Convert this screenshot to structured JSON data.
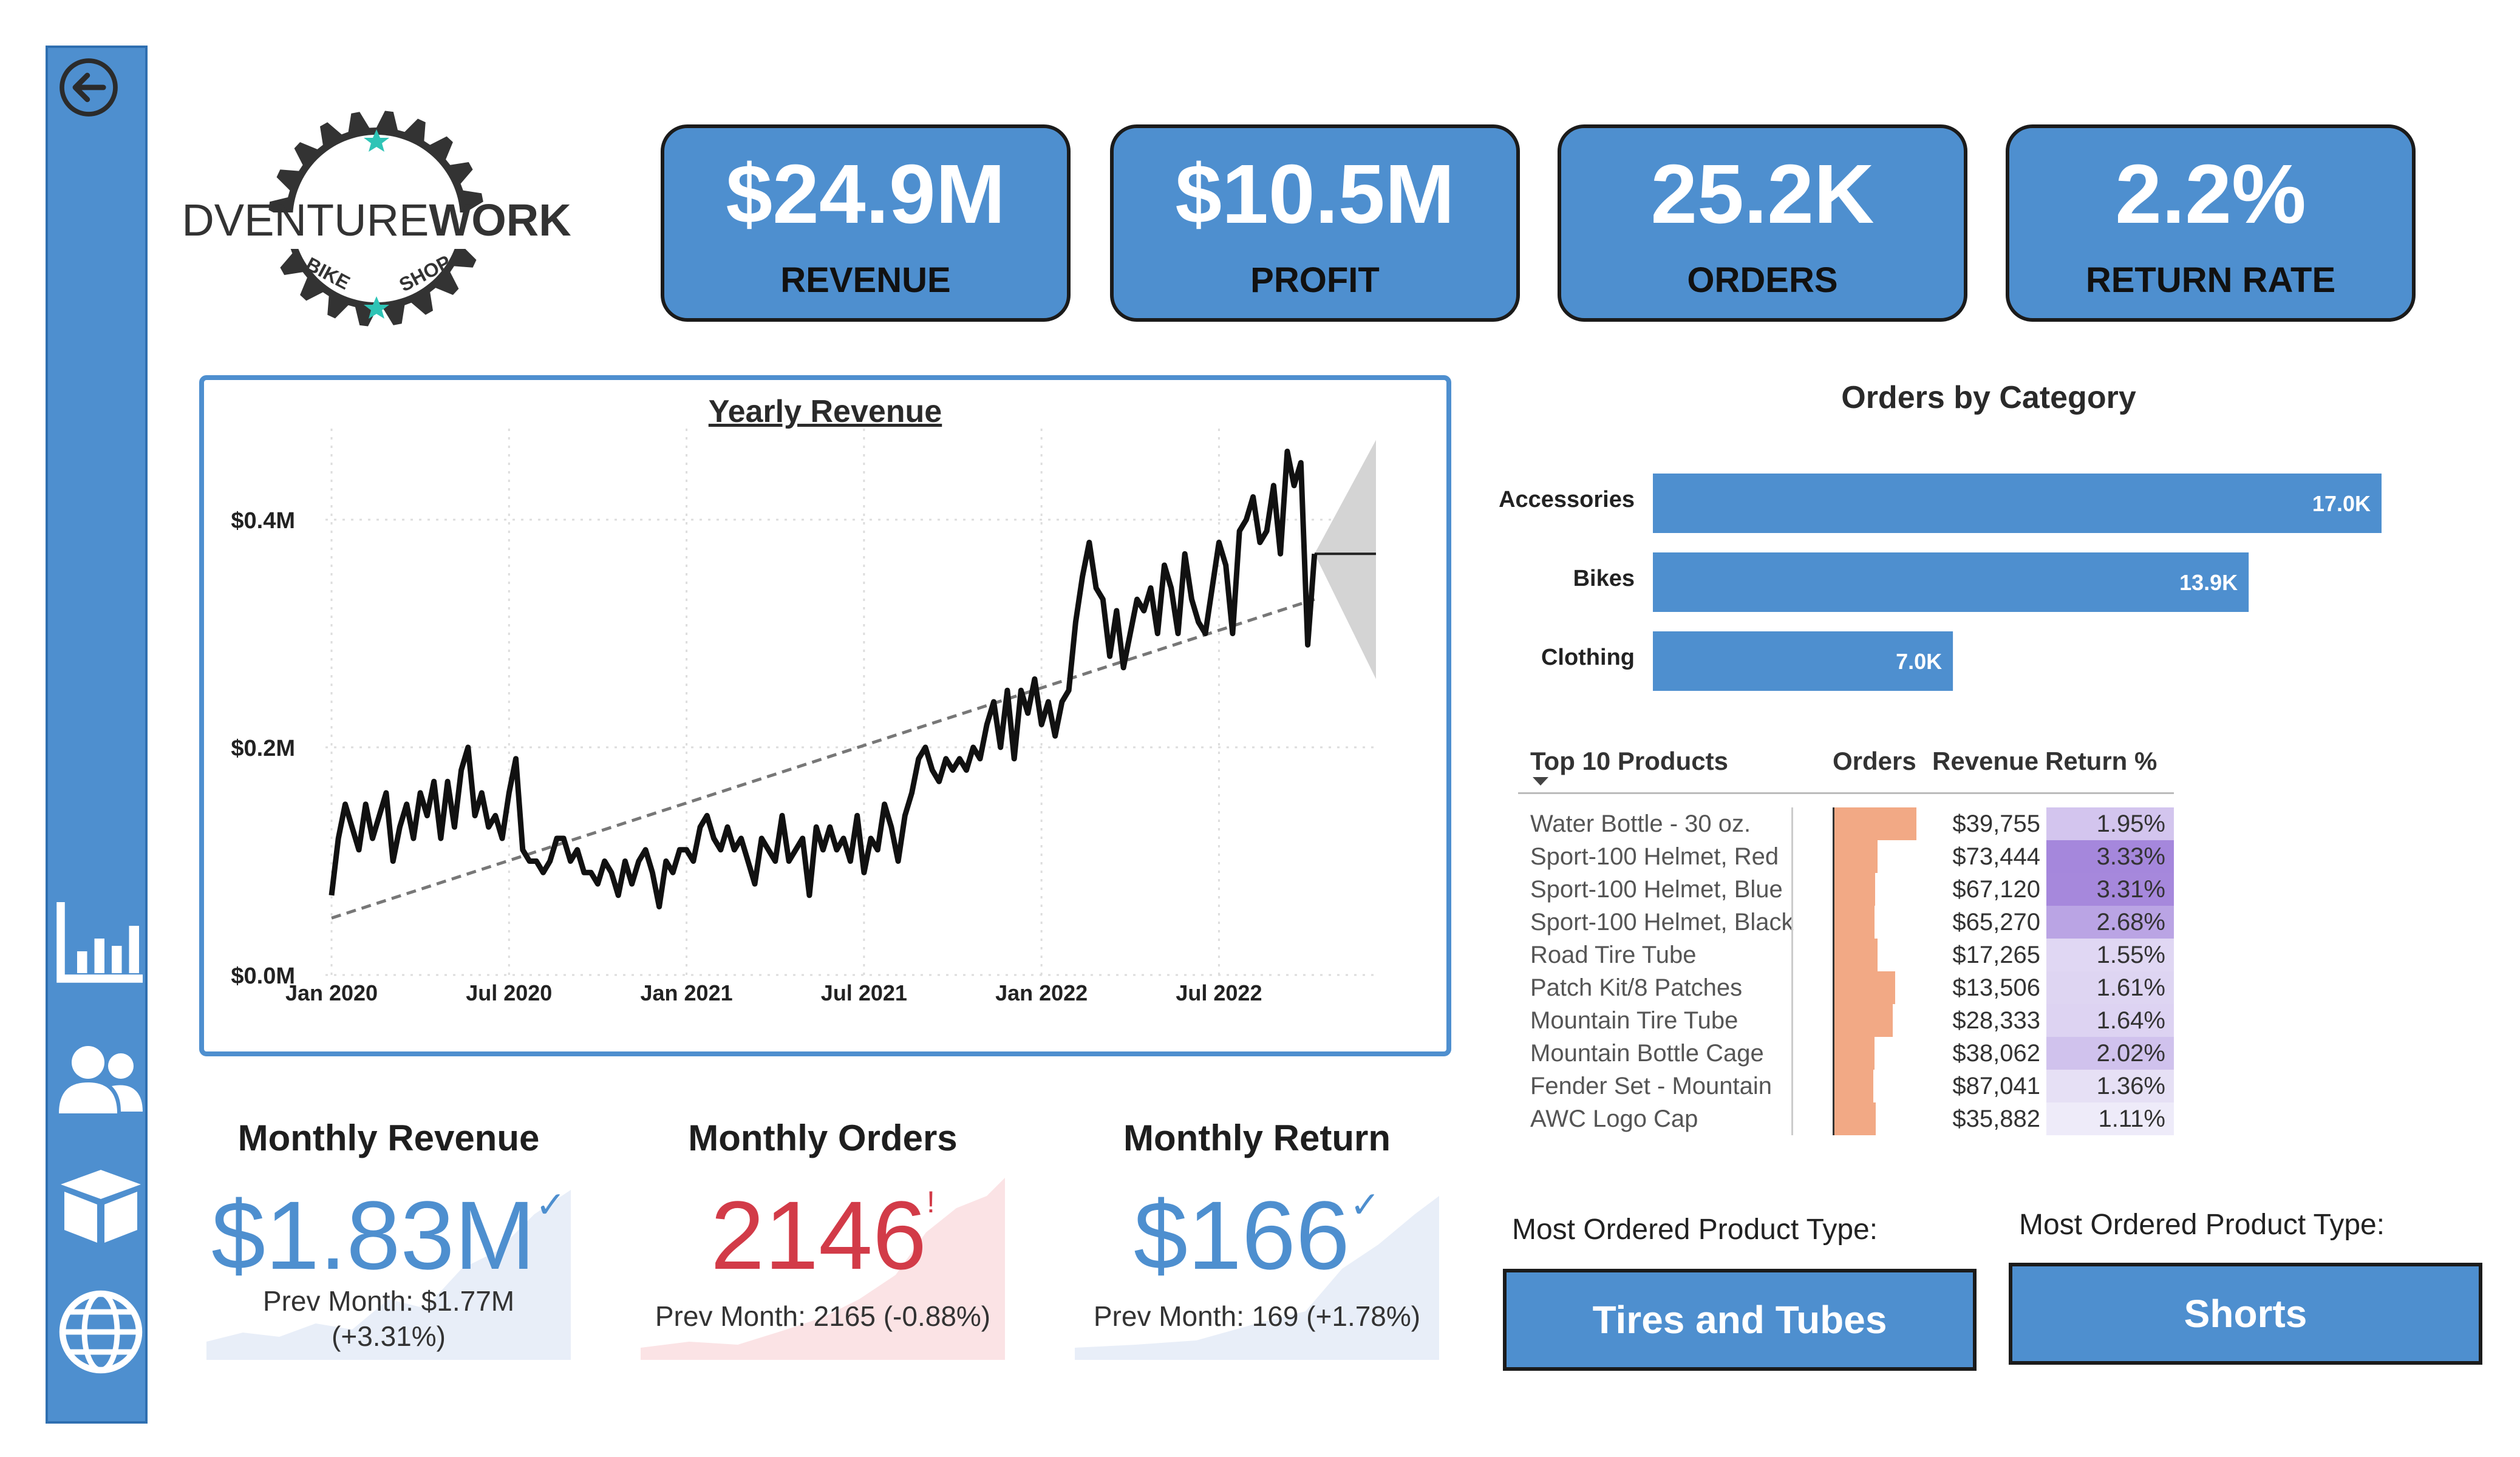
{
  "sidebar": {
    "items": [
      {
        "icon": "back-icon"
      },
      {
        "icon": "bar-chart-icon"
      },
      {
        "icon": "people-icon"
      },
      {
        "icon": "box-icon"
      },
      {
        "icon": "globe-icon"
      }
    ],
    "color": "#4e8fcf"
  },
  "logo": {
    "main_light": "ADVENTURE",
    "main_bold": "WORKS",
    "sub_left": "BIKE",
    "sub_right": "SHOP"
  },
  "kpis": [
    {
      "value": "$24.9M",
      "label": "REVENUE"
    },
    {
      "value": "$10.5M",
      "label": "PROFIT"
    },
    {
      "value": "25.2K",
      "label": "ORDERS"
    },
    {
      "value": "2.2%",
      "label": "RETURN RATE"
    }
  ],
  "yearly_revenue": {
    "title": "Yearly Revenue",
    "ytick_labels": [
      "$0.0M",
      "$0.2M",
      "$0.4M"
    ],
    "xtick_labels": [
      "Jan 2020",
      "Jul 2020",
      "Jan 2021",
      "Jul 2021",
      "Jan 2022",
      "Jul 2022"
    ]
  },
  "chart_data": [
    {
      "type": "line",
      "title": "Yearly Revenue",
      "ylabel": "",
      "xlabel": "",
      "ylim": [
        0,
        0.48
      ],
      "y_unit": "$M",
      "x_range": [
        "2020-01",
        "2022-10"
      ],
      "series": [
        {
          "values": [
            0.07,
            0.12,
            0.15,
            0.13,
            0.11,
            0.15,
            0.12,
            0.14,
            0.16,
            0.1,
            0.13,
            0.15,
            0.12,
            0.16,
            0.14,
            0.17,
            0.12,
            0.17,
            0.13,
            0.18,
            0.2,
            0.14,
            0.16,
            0.13,
            0.14,
            0.12,
            0.16,
            0.19,
            0.11,
            0.1,
            0.1,
            0.09,
            0.1,
            0.12,
            0.12,
            0.1,
            0.11,
            0.09,
            0.09,
            0.08,
            0.1,
            0.09,
            0.07,
            0.1,
            0.08,
            0.1,
            0.11,
            0.09,
            0.06,
            0.1,
            0.09,
            0.11,
            0.11,
            0.1,
            0.13,
            0.14,
            0.12,
            0.11,
            0.13,
            0.11,
            0.12,
            0.1,
            0.08,
            0.12,
            0.11,
            0.1,
            0.14,
            0.1,
            0.11,
            0.12,
            0.07,
            0.13,
            0.11,
            0.13,
            0.11,
            0.12,
            0.1,
            0.14,
            0.09,
            0.12,
            0.11,
            0.15,
            0.13,
            0.1,
            0.14,
            0.16,
            0.19,
            0.2,
            0.18,
            0.17,
            0.19,
            0.18,
            0.19,
            0.18,
            0.2,
            0.19,
            0.22,
            0.24,
            0.2,
            0.25,
            0.19,
            0.25,
            0.23,
            0.26,
            0.22,
            0.24,
            0.21,
            0.24,
            0.25,
            0.31,
            0.35,
            0.38,
            0.34,
            0.33,
            0.28,
            0.32,
            0.27,
            0.3,
            0.33,
            0.32,
            0.34,
            0.3,
            0.36,
            0.34,
            0.3,
            0.37,
            0.33,
            0.31,
            0.3,
            0.34,
            0.38,
            0.36,
            0.3,
            0.39,
            0.4,
            0.42,
            0.38,
            0.39,
            0.43,
            0.37,
            0.46,
            0.43,
            0.45,
            0.29,
            0.37
          ]
        },
        {
          "name": "",
          "type": "trend",
          "values_endpoints": [
            0.05,
            0.33
          ]
        }
      ],
      "forecast": {
        "value": 0.37,
        "upper": 0.47,
        "lower": 0.26
      },
      "grid": true
    },
    {
      "type": "bar",
      "orientation": "horizontal",
      "title": "Orders by Category",
      "categories": [
        "Accessories",
        "Bikes",
        "Clothing"
      ],
      "values": [
        17.0,
        13.9,
        7.0
      ],
      "value_labels": [
        "17.0K",
        "13.9K",
        "7.0K"
      ],
      "unit": "K",
      "color": "#4e8fcf"
    }
  ],
  "orders_by_category": {
    "title": "Orders by Category"
  },
  "top_products": {
    "headers": {
      "product": "Top 10 Products",
      "orders": "Orders",
      "revenue": "Revenue",
      "return": "Return %"
    },
    "rows": [
      {
        "name": "Water Bottle - 30 oz.",
        "orders_ratio": 1.0,
        "revenue": "$39,755",
        "return": "1.95%",
        "return_pct": 1.95
      },
      {
        "name": "Sport-100 Helmet, Red",
        "orders_ratio": 0.53,
        "revenue": "$73,444",
        "return": "3.33%",
        "return_pct": 3.33
      },
      {
        "name": "Sport-100 Helmet, Blue",
        "orders_ratio": 0.5,
        "revenue": "$67,120",
        "return": "3.31%",
        "return_pct": 3.31
      },
      {
        "name": "Sport-100 Helmet, Black",
        "orders_ratio": 0.49,
        "revenue": "$65,270",
        "return": "2.68%",
        "return_pct": 2.68
      },
      {
        "name": "Road Tire Tube",
        "orders_ratio": 0.53,
        "revenue": "$17,265",
        "return": "1.55%",
        "return_pct": 1.55
      },
      {
        "name": "Patch Kit/8 Patches",
        "orders_ratio": 0.74,
        "revenue": "$13,506",
        "return": "1.61%",
        "return_pct": 1.61
      },
      {
        "name": "Mountain Tire Tube",
        "orders_ratio": 0.71,
        "revenue": "$28,333",
        "return": "1.64%",
        "return_pct": 1.64
      },
      {
        "name": "Mountain Bottle Cage",
        "orders_ratio": 0.49,
        "revenue": "$38,062",
        "return": "2.02%",
        "return_pct": 2.02
      },
      {
        "name": "Fender Set - Mountain",
        "orders_ratio": 0.48,
        "revenue": "$87,041",
        "return": "1.36%",
        "return_pct": 1.36
      },
      {
        "name": "AWC Logo Cap",
        "orders_ratio": 0.51,
        "revenue": "$35,882",
        "return": "1.11%",
        "return_pct": 1.11
      }
    ]
  },
  "monthly": [
    {
      "title": "Monthly Revenue",
      "value": "$1.83M",
      "status": "✓",
      "prev_line1": "Prev Month: $1.77M",
      "prev_line2": "(+3.31%)",
      "color": "#4e8fcf",
      "bg": "#e8eef8"
    },
    {
      "title": "Monthly Orders",
      "value": "2146",
      "status": "!",
      "prev_line1": "Prev Month: 2165 (-0.88%)",
      "prev_line2": "",
      "color": "#d23b48",
      "bg": "#fbe3e5"
    },
    {
      "title": "Monthly Return",
      "value": "$166",
      "status": "✓",
      "prev_line1": "Prev Month: 169 (+1.78%)",
      "prev_line2": "",
      "color": "#4e8fcf",
      "bg": "#e8eef8"
    }
  ],
  "product_types": [
    {
      "label": "Most Ordered Product Type:",
      "value": "Tires and Tubes"
    },
    {
      "label": "Most Ordered Product Type:",
      "value": "Shorts"
    }
  ]
}
